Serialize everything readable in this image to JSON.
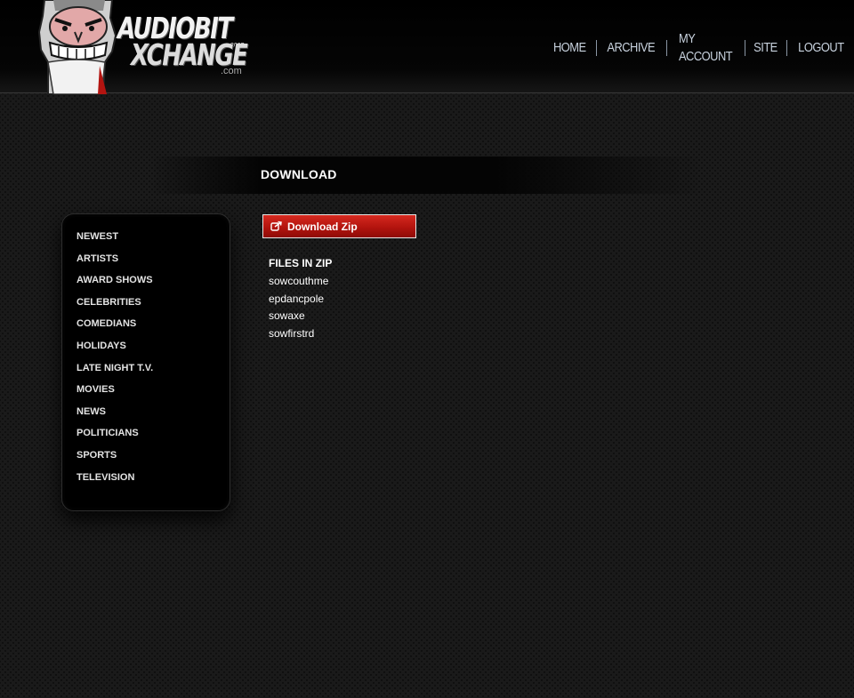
{
  "logo": {
    "line1": "AUDIOBIT",
    "line2": "XCHANGE",
    "suffix": ".com",
    "tag": "2007",
    "mascot": "grinning-face-logo-icon"
  },
  "nav": {
    "items": [
      {
        "label": "HOME"
      },
      {
        "label": "ARCHIVE"
      },
      {
        "label": "MY ACCOUNT"
      },
      {
        "label": "SITE"
      },
      {
        "label": "LOGOUT"
      }
    ]
  },
  "page": {
    "title": "DOWNLOAD"
  },
  "sidebar": {
    "items": [
      {
        "label": "NEWEST"
      },
      {
        "label": "ARTISTS"
      },
      {
        "label": "AWARD SHOWS"
      },
      {
        "label": "CELEBRITIES"
      },
      {
        "label": "COMEDIANS"
      },
      {
        "label": "HOLIDAYS"
      },
      {
        "label": "LATE NIGHT T.V."
      },
      {
        "label": "MOVIES"
      },
      {
        "label": "NEWS"
      },
      {
        "label": "POLITICIANS"
      },
      {
        "label": "SPORTS"
      },
      {
        "label": "TELEVISION"
      }
    ]
  },
  "download": {
    "label": "Download Zip",
    "icon": "external-link-icon"
  },
  "files": {
    "heading": "FILES IN ZIP",
    "items": [
      "sowcouthme",
      "epdancpole",
      "sowaxe",
      "sowfirstrd"
    ]
  },
  "colors": {
    "accent": "#b3140e",
    "nav_text": "#c8d2de",
    "background": "#1a1a1a"
  }
}
